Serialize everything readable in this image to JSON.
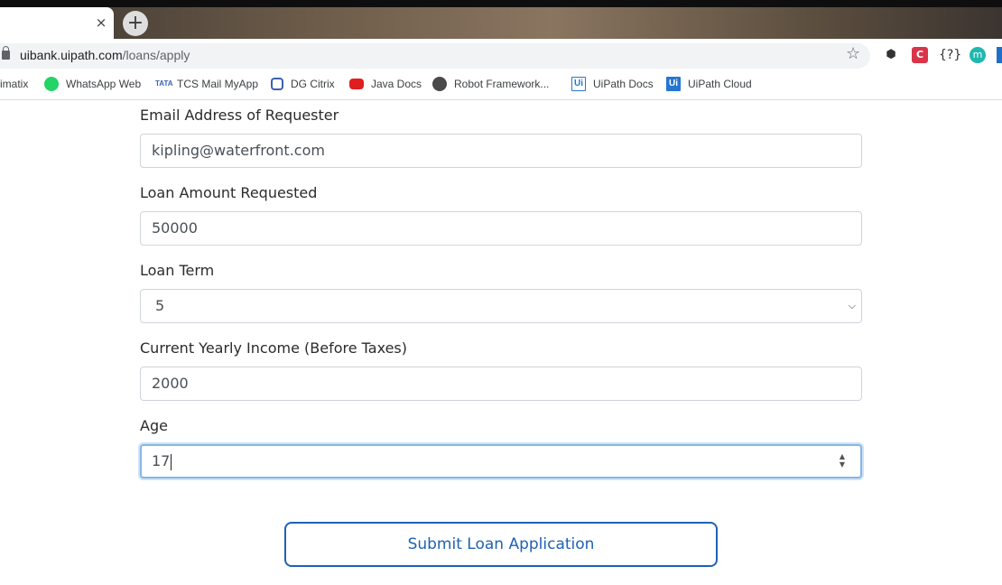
{
  "browser": {
    "tab_close": "×",
    "new_tab": "+",
    "url_host": "uibank.uipath.com",
    "url_path": "/loans/apply",
    "star": "☆",
    "extensions": {
      "box": "⬢",
      "red": "C",
      "curly": "{?}",
      "m": "m"
    },
    "bookmarks": [
      {
        "label": "imatix",
        "icon": "none"
      },
      {
        "label": "WhatsApp Web",
        "icon": "whatsapp-icon"
      },
      {
        "label": "TCS Mail MyApp",
        "icon": "tcs-icon"
      },
      {
        "label": "DG Citrix",
        "icon": "citrix-icon"
      },
      {
        "label": "Java Docs",
        "icon": "oracle-icon"
      },
      {
        "label": "Robot Framework...",
        "icon": "robot-framework-icon"
      },
      {
        "label": "UiPath Docs",
        "icon": "uipath-icon"
      },
      {
        "label": "UiPath Cloud",
        "icon": "uipath-icon"
      }
    ],
    "bookmark_icon_text": {
      "tcs": "TATA",
      "ui": "Ui"
    }
  },
  "form": {
    "email_label": "Email Address of Requester",
    "email_value": "kipling@waterfront.com",
    "amount_label": "Loan Amount Requested",
    "amount_value": "50000",
    "term_label": "Loan Term",
    "term_value": "5",
    "income_label": "Current Yearly Income (Before Taxes)",
    "income_value": "2000",
    "age_label": "Age",
    "age_value": "17",
    "submit_label": "Submit Loan Application"
  },
  "colors": {
    "accent": "#1f61b5",
    "focus_ring": "#86b7e6",
    "field_border": "#cfd4da"
  }
}
